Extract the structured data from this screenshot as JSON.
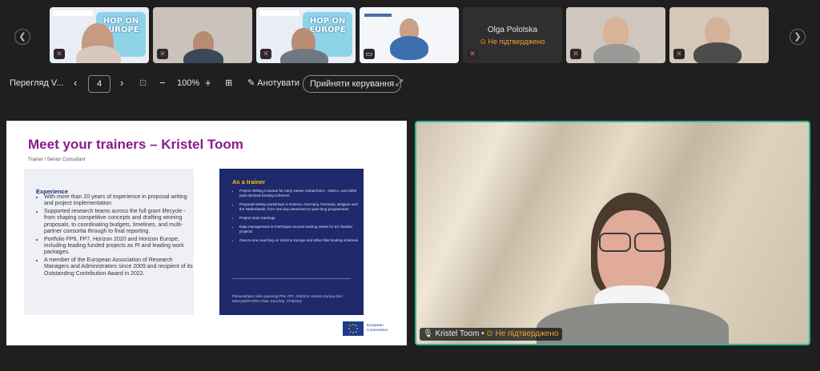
{
  "participants": [
    {
      "name": "",
      "status": ""
    },
    {
      "name": "",
      "status": ""
    },
    {
      "name": "",
      "status": ""
    },
    {
      "name": "",
      "status": ""
    },
    {
      "name": "Olga Polotska",
      "status": "Не підтверджено"
    },
    {
      "name": "",
      "status": ""
    },
    {
      "name": "",
      "status": ""
    }
  ],
  "slide_branding": {
    "hop_on_text": "HOP ON EUROPE"
  },
  "toolbar": {
    "view_label": "Перегляд V...",
    "page_number": "4",
    "zoom": "100%",
    "annotate_label": "Анотувати",
    "take_control_label": "Прийняти керування"
  },
  "slide": {
    "title": "Meet your trainers – Kristel Toom",
    "subtitle": "Trainer / Senior Consultant",
    "experience_heading": "Experience",
    "experience_items": [
      "With more than 20 years of experience in proposal writing and project implementation",
      "Supported research teams across the full grant lifecycle - from shaping competitive concepts and drafting winning proposals, to coordinating budgets, timelines, and multi-partner consortia through to final reporting.",
      "Portfolio FP6, FP7, Horizon 2020 and Horizon Europe, including leading funded projects as PI and leading work packages.",
      "A member of the European Association of Research Managers and Administrators since 2009 and recipient of its Outstanding Contribution Award in 2022."
    ],
    "trainer_heading": "As a trainer",
    "trainer_items": [
      "Project Writing Courses for early-career researchers – MSCA, and other post-doctoral funding schemes",
      "Proposal-writing workshops in Estonia, Germany, Romania, Belgium and the Netherlands, from one-day intensives to year-long programmes",
      "Project team trainings",
      "Data management & FAIR/open-access training series for EC-funded projects",
      "One-to-one coaching on Horizon Europe and other R&I funding schemes"
    ],
    "trainer_footnote": "PI/coordinator roles spanning FP6, FP7, H2020 & Horizon Europe (incl. MarCySEFA ERA Chair, EuroTeQ, ATHENA)",
    "logo_text_line1": "European",
    "logo_text_line2": "Commission"
  },
  "speaker": {
    "name": "Kristel Toom",
    "status": "Не підтверджено"
  },
  "colors": {
    "accent_border": "#36b39b",
    "warning": "#f0a030",
    "slide_title": "#8b1a8b",
    "slide_navy": "#1e2a6b"
  }
}
